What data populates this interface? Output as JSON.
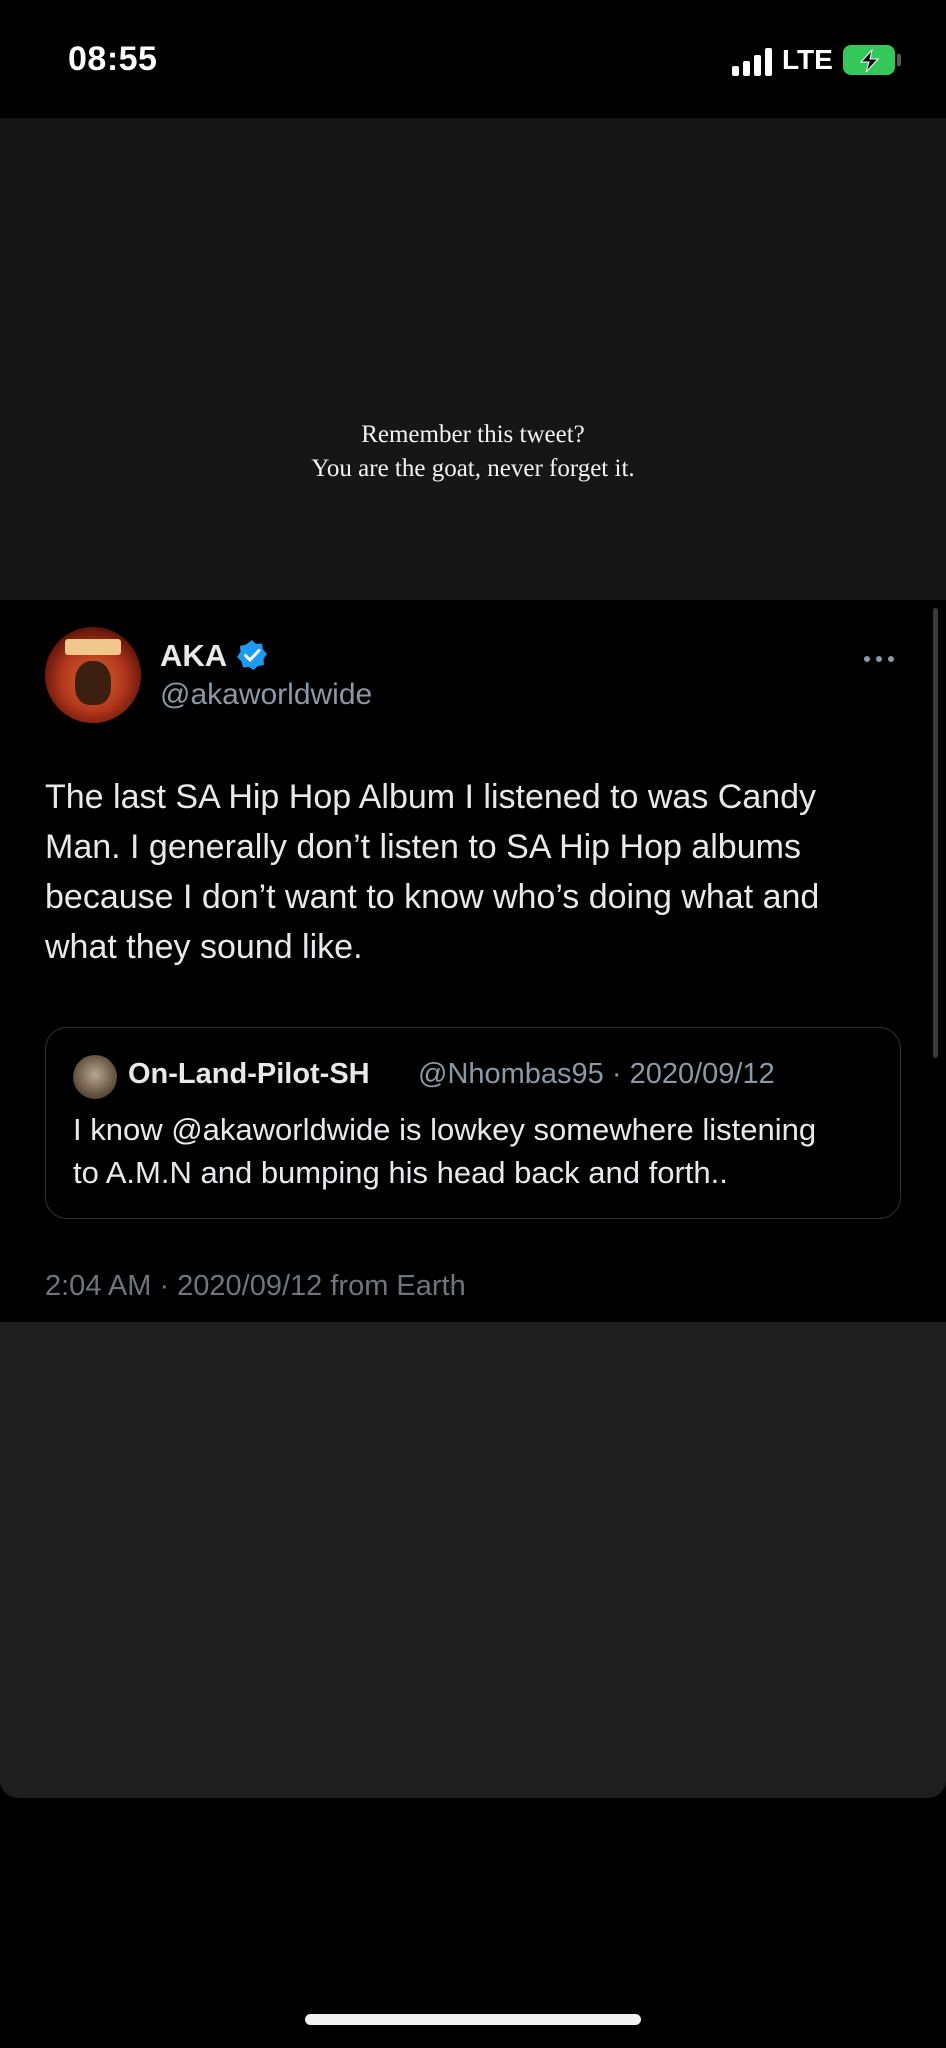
{
  "status_bar": {
    "time": "08:55",
    "network": "LTE",
    "signal_icon": "cellular-signal-icon",
    "battery_icon": "battery-charging-icon",
    "battery_color": "#34c759"
  },
  "story": {
    "caption_line1": "Remember this tweet?",
    "caption_line2": "You are the goat, never forget it."
  },
  "tweet": {
    "display_name": "AKA",
    "verified": true,
    "verified_color": "#1d9bf0",
    "handle": "@akaworldwide",
    "text_lines": [
      "The last SA Hip Hop Album I listened to was Candy",
      "Man. I generally don’t listen to SA Hip Hop albums",
      "because I don’t want to know who’s doing what and",
      "what they sound like."
    ],
    "quote": {
      "name": "On-Land-Pilot-SH",
      "meta": "@Nhombas95 · 2020/09/12",
      "text_lines": [
        "I know @akaworldwide is lowkey somewhere listening",
        "to A.M.N and bumping his head back and forth.."
      ]
    },
    "timestamp": "2:04 AM · 2020/09/12 from Earth"
  }
}
